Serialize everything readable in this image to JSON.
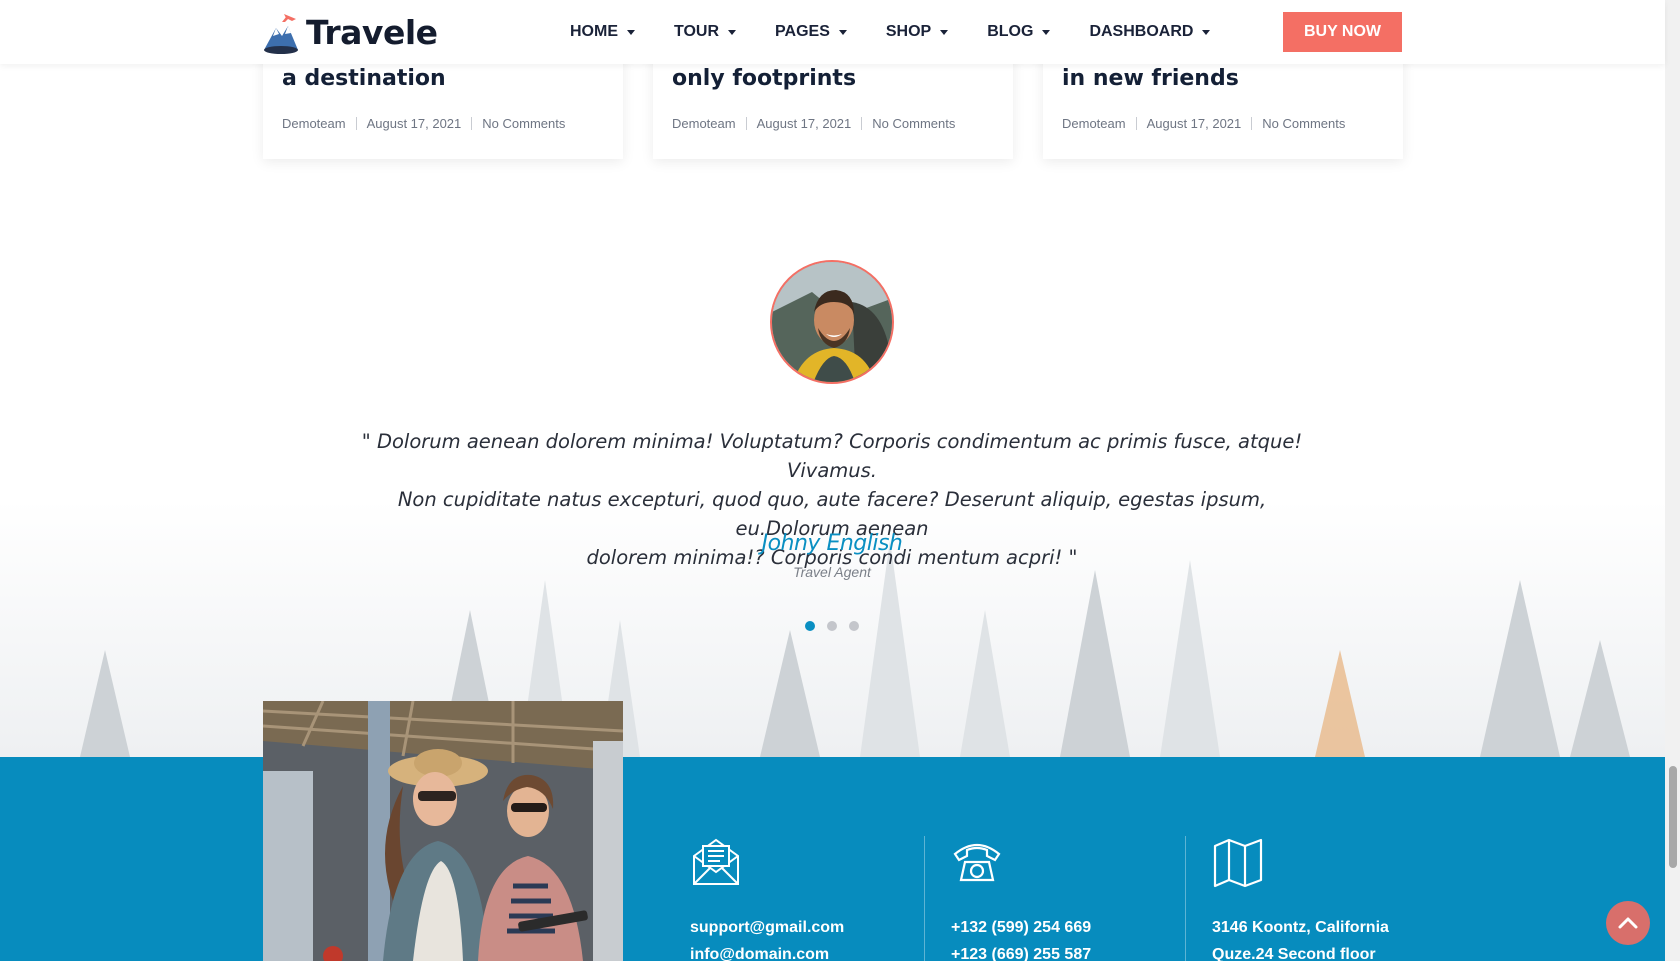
{
  "brand": {
    "name": "Travele"
  },
  "nav": [
    {
      "label": "HOME"
    },
    {
      "label": "TOUR"
    },
    {
      "label": "PAGES"
    },
    {
      "label": "SHOP"
    },
    {
      "label": "BLOG"
    },
    {
      "label": "DASHBOARD"
    }
  ],
  "buy_button": "BUY NOW",
  "blog_cards": [
    {
      "title": "a destination",
      "author": "Demoteam",
      "date": "August 17, 2021",
      "comments": "No Comments"
    },
    {
      "title": "only footprints",
      "author": "Demoteam",
      "date": "August 17, 2021",
      "comments": "No Comments"
    },
    {
      "title": "in new friends",
      "author": "Demoteam",
      "date": "August 17, 2021",
      "comments": "No Comments"
    }
  ],
  "testimonial": {
    "quote_line1": "\" Dolorum aenean dolorem minima! Voluptatum? Corporis condimentum ac primis fusce, atque! Vivamus.",
    "quote_line2": "Non cupiditate natus excepturi, quod quo, aute facere? Deserunt aliquip, egestas ipsum, eu.Dolorum aenean",
    "quote_line3": "dolorem minima!? Corporis condi mentum acpri! \"",
    "author": "Johny English",
    "role": "Travel Agent",
    "slides": 3,
    "active_slide": 1
  },
  "contact": {
    "email": {
      "icon": "envelope-icon",
      "line1": "support@gmail.com",
      "line2": "info@domain.com"
    },
    "phone": {
      "icon": "telephone-icon",
      "line1": "+132 (599) 254 669",
      "line2": "+123 (669) 255 587"
    },
    "address": {
      "icon": "map-icon",
      "line1": "3146 Koontz, California",
      "line2": "Quze.24 Second floor"
    }
  },
  "colors": {
    "accent": "#f46f64",
    "primary_blue": "#078cbe",
    "link_blue": "#0a8fc2",
    "heading": "#142036"
  }
}
